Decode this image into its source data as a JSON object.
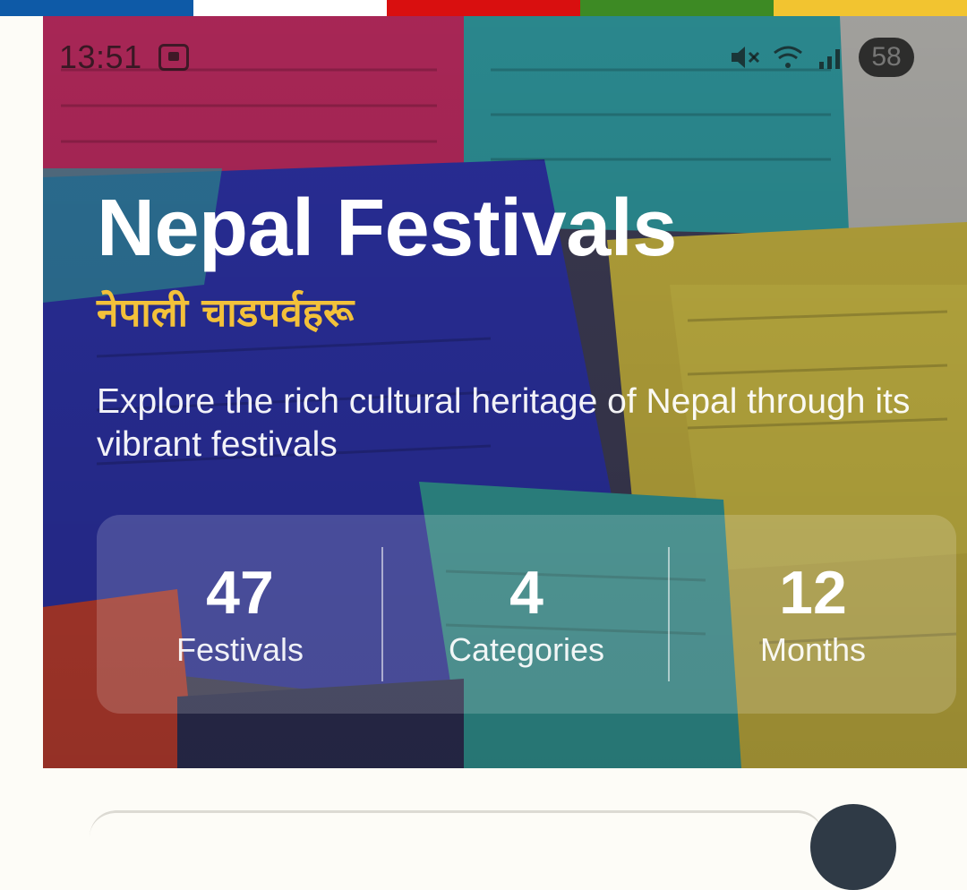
{
  "flag_colors": [
    "#0e5aa7",
    "#ffffff",
    "#d90f0f",
    "#3d8a24",
    "#f2c430"
  ],
  "status_bar": {
    "time": "13:51",
    "screen_record_icon": "screen-record-icon",
    "mute_icon": "mute-icon",
    "wifi_icon": "wifi-icon",
    "signal_icon": "signal-icon",
    "battery": "58"
  },
  "hero": {
    "title": "Nepal Festivals",
    "subtitle": "नेपाली चाडपर्वहरू",
    "description": "Explore the rich cultural heritage of Nepal through its vibrant festivals",
    "title_color": "#ffffff",
    "subtitle_color": "#f3c13a"
  },
  "stats": [
    {
      "value": "47",
      "label": "Festivals"
    },
    {
      "value": "4",
      "label": "Categories"
    },
    {
      "value": "12",
      "label": "Months"
    }
  ]
}
